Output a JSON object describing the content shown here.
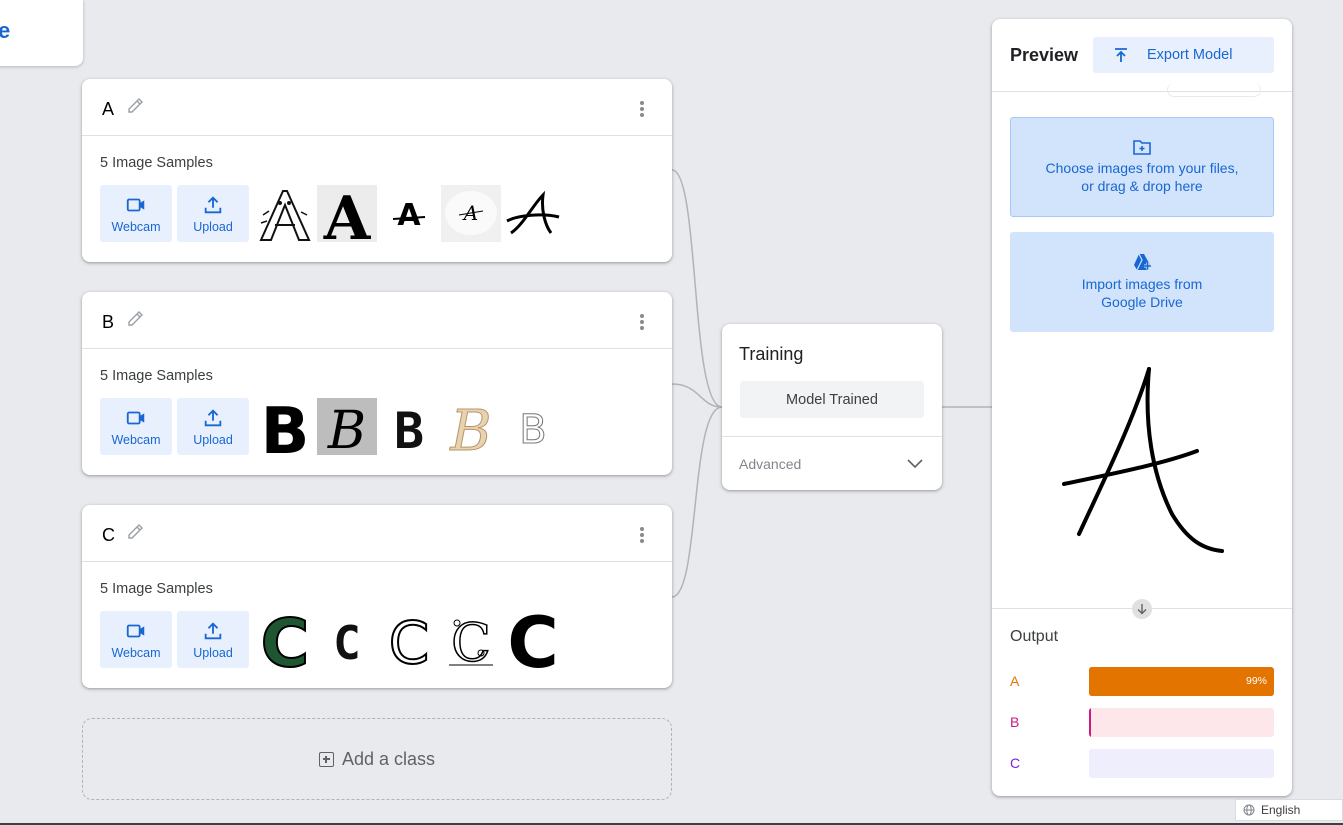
{
  "corner_card": {
    "text": "e"
  },
  "classes": [
    {
      "name": "A",
      "samples_label": "5 Image Samples",
      "webcam_label": "Webcam",
      "upload_label": "Upload",
      "thumbnails": [
        "A",
        "A",
        "A",
        "A",
        "A"
      ]
    },
    {
      "name": "B",
      "samples_label": "5 Image Samples",
      "webcam_label": "Webcam",
      "upload_label": "Upload",
      "thumbnails": [
        "B",
        "B",
        "B",
        "B",
        "B"
      ]
    },
    {
      "name": "C",
      "samples_label": "5 Image Samples",
      "webcam_label": "Webcam",
      "upload_label": "Upload",
      "thumbnails": [
        "C",
        "C",
        "C",
        "C",
        "C"
      ]
    }
  ],
  "add_class_label": "Add a class",
  "training": {
    "title": "Training",
    "status_button": "Model Trained",
    "advanced_label": "Advanced"
  },
  "preview": {
    "title": "Preview",
    "export_label": "Export Model",
    "upload_line1": "Choose images from your files,",
    "upload_line2": "or drag & drop here",
    "drive_line1": "Import images from",
    "drive_line2": "Google Drive",
    "preview_letter": "A",
    "output_title": "Output",
    "outputs": [
      {
        "label": "A",
        "confidence": 0.99,
        "percent_text": "99%",
        "color": "#e37400",
        "track": "#e37400"
      },
      {
        "label": "B",
        "confidence": 0.01,
        "percent_text": "",
        "color": "#d01884",
        "track": "#fde7ea"
      },
      {
        "label": "C",
        "confidence": 0.0,
        "percent_text": "",
        "color": "#7b1fe0",
        "track": "#eeeefc"
      }
    ]
  },
  "language": "English",
  "colors": {
    "accent": "#1967d2",
    "accent_bg": "#e8f0fe",
    "dropzone_bg": "#d2e3fc"
  },
  "icons": [
    "pencil-icon",
    "more-vert-icon",
    "videocam-icon",
    "upload-icon",
    "export-icon",
    "folder-add-icon",
    "drive-add-icon",
    "chevron-down-icon",
    "arrow-down-icon",
    "globe-icon",
    "add-box-icon"
  ]
}
